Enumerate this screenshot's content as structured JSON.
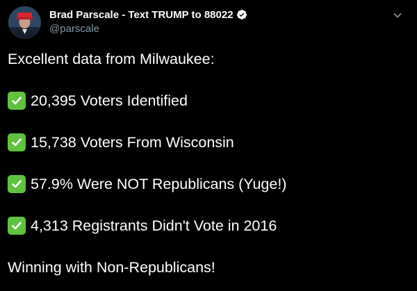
{
  "author": {
    "display_name": "Brad Parscale - Text TRUMP to 88022",
    "handle": "@parscale",
    "avatar_icon": "user-avatar",
    "verified_icon": "verified-badge-icon"
  },
  "menu": {
    "icon": "chevron-down-icon"
  },
  "tweet": {
    "intro": "Excellent data from Milwaukee:",
    "items": [
      {
        "check": "✅",
        "text": "20,395 Voters Identified"
      },
      {
        "check": "✅",
        "text": "15,738 Voters From Wisconsin"
      },
      {
        "check": "✅",
        "text": "57.9% Were NOT Republicans (Yuge!)"
      },
      {
        "check": "✅",
        "text": "4,313 Registrants Didn't Vote in 2016"
      }
    ],
    "closing": "Winning with Non-Republicans!"
  },
  "colors": {
    "background": "#000000",
    "text": "#ffffff",
    "secondary_text": "#8899a6",
    "check_green": "#5fc33d"
  }
}
